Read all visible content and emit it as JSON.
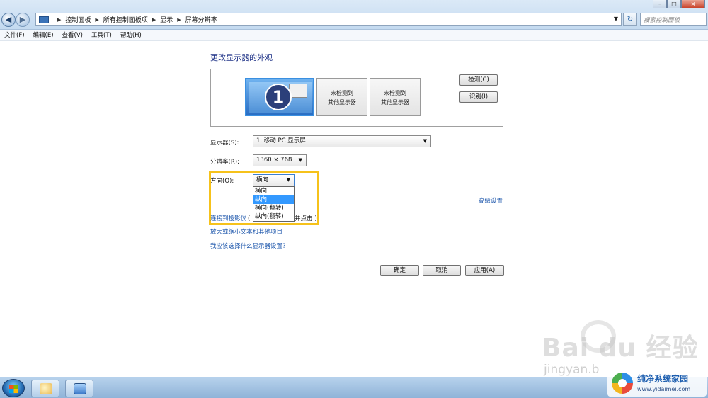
{
  "window": {
    "breadcrumbs": [
      "控制面板",
      "所有控制面板项",
      "显示",
      "屏幕分辨率"
    ],
    "search_placeholder": "搜索控制面板",
    "minimize": "–",
    "maximize": "□",
    "close": "×"
  },
  "menu": [
    "文件(F)",
    "编辑(E)",
    "查看(V)",
    "工具(T)",
    "帮助(H)"
  ],
  "page": {
    "title": "更改显示器的外观",
    "monitors": [
      {
        "number": "1"
      },
      {
        "line1": "未检测到",
        "line2": "其他显示器"
      },
      {
        "line1": "未检测到",
        "line2": "其他显示器"
      }
    ],
    "detect_button": "检测(C)",
    "identify_button": "识别(I)",
    "display_label": "显示器(S):",
    "display_value": "1. 移动 PC 显示屏",
    "resolution_label": "分辨率(R):",
    "resolution_value": "1360 × 768",
    "orientation_label": "方向(O):",
    "orientation_value": "横向",
    "orientation_options": [
      "横向",
      "纵向",
      "横向(翻转)",
      "纵向(翻转)"
    ],
    "orientation_selected_index": 1,
    "advanced_link": "高级设置",
    "projector_link": "连接到投影仪",
    "projector_link_tail": "(",
    "projector_tail_text": "并点击",
    "projector_tail_end": ")",
    "text_size_link": "放大或缩小文本和其他项目",
    "which_settings_link": "我应该选择什么显示器设置?",
    "ok_button": "确定",
    "cancel_button": "取消",
    "apply_button": "应用(A)"
  },
  "watermark": {
    "baidu": "Bai du 经验",
    "jingyan": "jingyan.b"
  },
  "badge": {
    "title": "纯净系统家园",
    "url": "www.yidaimei.com"
  },
  "colors": {
    "link": "#1b55ab",
    "title": "#1e3287",
    "highlight": "#f6c21b",
    "selection": "#3399ff"
  }
}
